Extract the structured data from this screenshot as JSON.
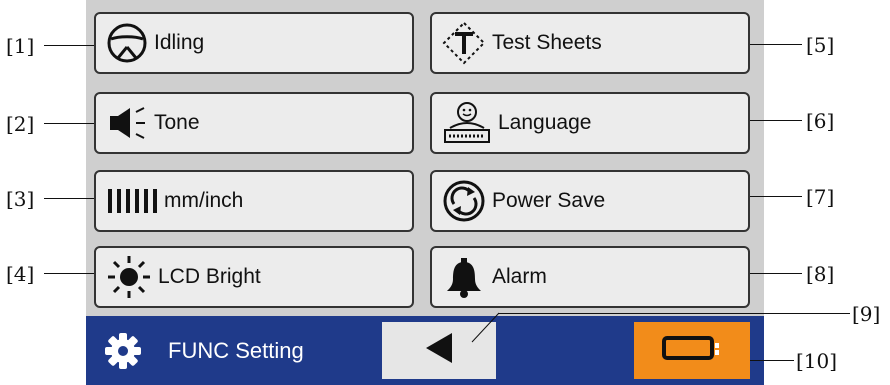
{
  "menu": {
    "left": [
      {
        "label": "Idling",
        "callout": "[1]"
      },
      {
        "label": "Tone",
        "callout": "[2]"
      },
      {
        "label": "mm/inch",
        "callout": "[3]"
      },
      {
        "label": "LCD Bright",
        "callout": "[4]"
      }
    ],
    "right": [
      {
        "label": "Test Sheets",
        "callout": "[5]"
      },
      {
        "label": "Language",
        "callout": "[6]"
      },
      {
        "label": "Power Save",
        "callout": "[7]"
      },
      {
        "label": "Alarm",
        "callout": "[8]"
      }
    ]
  },
  "footer": {
    "title": "FUNC Setting",
    "back_callout": "[9]",
    "home_callout": "[10]"
  },
  "colors": {
    "footer_bg": "#1f3a8a",
    "home_button": "#f28c1a"
  },
  "icons": {
    "idling": "steering-wheel-icon",
    "tone": "speaker-icon",
    "mm_inch": "ruler-icon",
    "lcd_bright": "sun-icon",
    "test_sheets": "test-sheet-icon",
    "language": "keyboard-person-icon",
    "power_save": "power-cycle-icon",
    "alarm": "bell-icon",
    "footer": "gear-icon",
    "back": "back-arrow-icon",
    "home": "home-frame-icon"
  }
}
